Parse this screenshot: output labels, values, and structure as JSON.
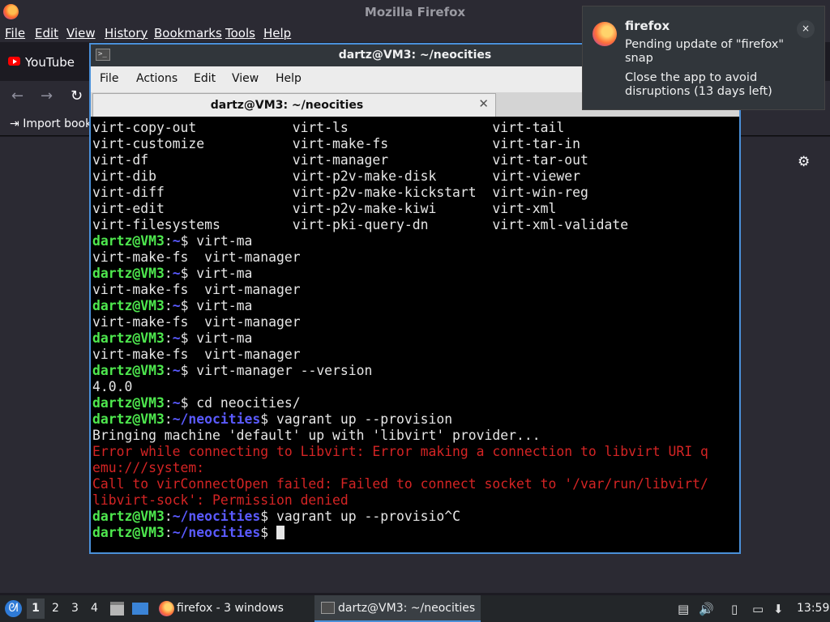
{
  "firefox": {
    "window_title": "Mozilla Firefox",
    "menu": [
      "File",
      "Edit",
      "View",
      "History",
      "Bookmarks",
      "Tools",
      "Help"
    ],
    "tab_youtube": "YouTube",
    "nav": {
      "back": "←",
      "forward": "→",
      "reload": "↻"
    },
    "import_bookmarks": "Import book",
    "gear": "⚙"
  },
  "terminal": {
    "title": "dartz@VM3: ~/neocities",
    "icon_glyph": ">_",
    "menu": [
      "File",
      "Actions",
      "Edit",
      "View",
      "Help"
    ],
    "tab_label": "dartz@VM3: ~/neocities",
    "tab_close": "✕",
    "lines": [
      "virt-copy-out            virt-ls                  virt-tail",
      "virt-customize           virt-make-fs             virt-tar-in",
      "virt-df                  virt-manager             virt-tar-out",
      "virt-dib                 virt-p2v-make-disk       virt-viewer",
      "virt-diff                virt-p2v-make-kickstart  virt-win-reg",
      "virt-edit                virt-p2v-make-kiwi       virt-xml",
      "virt-filesystems         virt-pki-query-dn        virt-xml-validate",
      {
        "user": "dartz@VM3",
        "sep": ":",
        "path": "~",
        "cmd": "$ virt-ma"
      },
      "virt-make-fs  virt-manager",
      {
        "user": "dartz@VM3",
        "sep": ":",
        "path": "~",
        "cmd": "$ virt-ma"
      },
      "virt-make-fs  virt-manager",
      {
        "user": "dartz@VM3",
        "sep": ":",
        "path": "~",
        "cmd": "$ virt-ma"
      },
      "virt-make-fs  virt-manager",
      {
        "user": "dartz@VM3",
        "sep": ":",
        "path": "~",
        "cmd": "$ virt-ma"
      },
      "virt-make-fs  virt-manager",
      {
        "user": "dartz@VM3",
        "sep": ":",
        "path": "~",
        "cmd": "$ virt-manager --version"
      },
      "4.0.0",
      {
        "user": "dartz@VM3",
        "sep": ":",
        "path": "~",
        "cmd": "$ cd neocities/"
      },
      {
        "user": "dartz@VM3",
        "sep": ":",
        "path": "~/neocities",
        "cmd": "$ vagrant up --provision"
      },
      "Bringing machine 'default' up with 'libvirt' provider...",
      {
        "error": "Error while connecting to Libvirt: Error making a connection to libvirt URI q"
      },
      {
        "error": "emu:///system:"
      },
      {
        "error": "Call to virConnectOpen failed: Failed to connect socket to '/var/run/libvirt/"
      },
      {
        "error": "libvirt-sock': Permission denied"
      },
      {
        "user": "dartz@VM3",
        "sep": ":",
        "path": "~/neocities",
        "cmd": "$ vagrant up --provisio^C"
      },
      {
        "user": "dartz@VM3",
        "sep": ":",
        "path": "~/neocities",
        "cmd": "$ ",
        "cursor": true
      }
    ]
  },
  "notification": {
    "app": "firefox",
    "close": "×",
    "line1": "Pending update of \"firefox\"",
    "line2": "snap",
    "line3": "Close the app to avoid",
    "line4": "disruptions (13 days left)"
  },
  "panel": {
    "start_glyph": "ᘛ",
    "workspaces": [
      "1",
      "2",
      "3",
      "4"
    ],
    "task_firefox": "firefox - 3 windows",
    "task_terminal": "dartz@VM3: ~/neocities",
    "tray": {
      "clipboard": "▤",
      "volume": "🔊",
      "notes": "▯",
      "display": "▭",
      "updates": "⬇"
    },
    "clock": "13:59"
  },
  "colors": {
    "prompt_user": "#4ee84e",
    "prompt_path": "#5a5aff",
    "error": "#d42424",
    "window_accent": "#4a90d9"
  }
}
